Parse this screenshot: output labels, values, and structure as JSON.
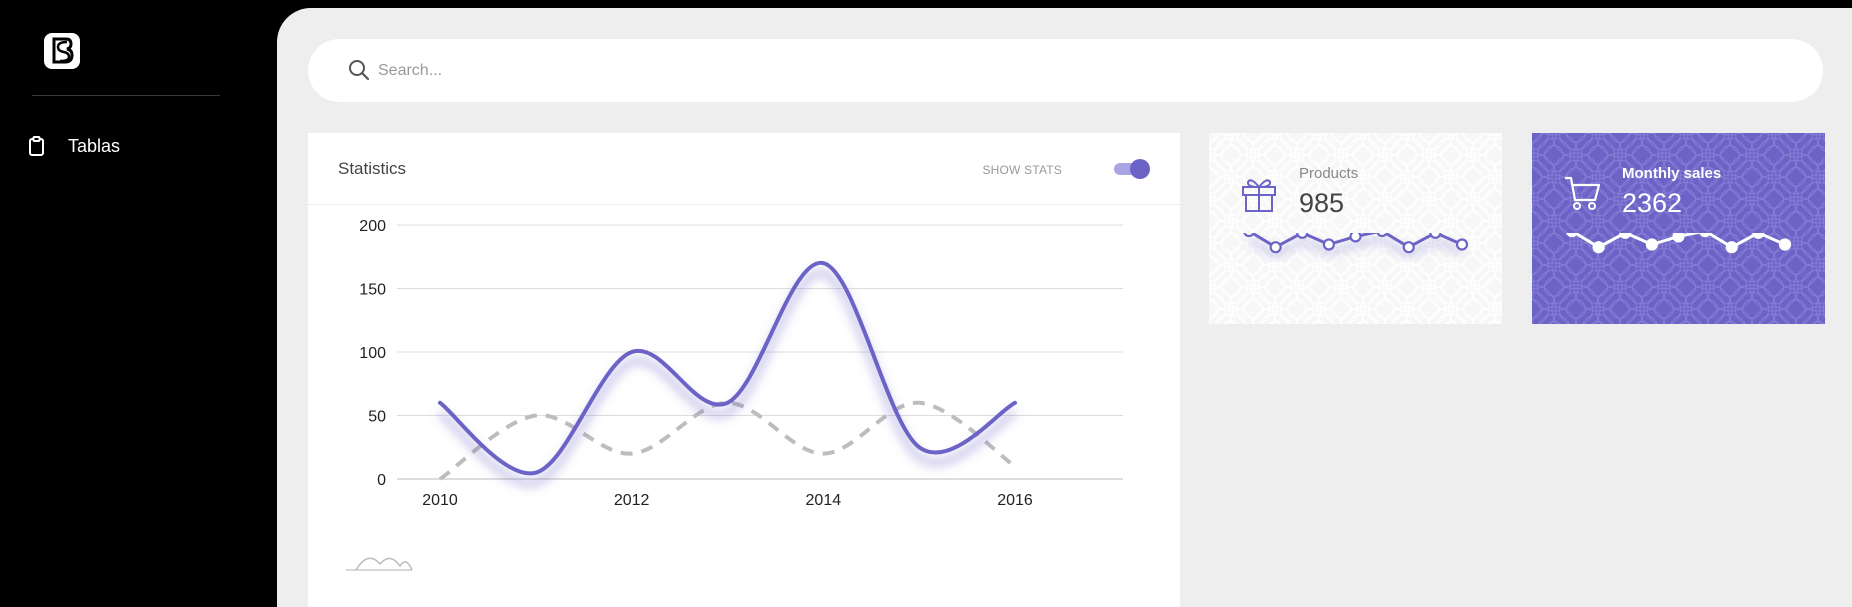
{
  "sidebar": {
    "logo_icon": "logo-icon",
    "items": [
      {
        "label": "Tablas",
        "icon": "clipboard-icon"
      }
    ]
  },
  "search": {
    "placeholder": "Search...",
    "icon": "search-icon"
  },
  "statistics": {
    "title": "Statistics",
    "toggle_label": "SHOW STATS",
    "toggle_on": true
  },
  "products": {
    "label": "Products",
    "value": "985",
    "icon": "gift-icon",
    "spark": [
      60,
      42,
      58,
      45,
      54,
      60,
      42,
      58,
      45
    ]
  },
  "monthly_sales": {
    "label": "Monthly sales",
    "value": "2362",
    "icon": "cart-icon",
    "spark": [
      60,
      42,
      58,
      45,
      54,
      60,
      42,
      58,
      45
    ]
  },
  "colors": {
    "accent": "#6c63c7",
    "secondary_series": "#bdbdbd",
    "background": "#eeeeee",
    "sidebar": "#000000"
  },
  "chart_data": {
    "type": "line",
    "x": [
      2010,
      2011,
      2012,
      2013,
      2014,
      2015,
      2016
    ],
    "x_tick_labels": [
      "2010",
      "2012",
      "2014",
      "2016"
    ],
    "y_ticks": [
      0,
      50,
      100,
      150,
      200
    ],
    "ylim": [
      0,
      200
    ],
    "grid": true,
    "series": [
      {
        "values": [
          60,
          5,
          100,
          60,
          170,
          25,
          60
        ],
        "color": "#6c63c7",
        "style": "solid"
      },
      {
        "values": [
          0,
          50,
          20,
          60,
          20,
          60,
          10
        ],
        "color": "#bdbdbd",
        "style": "dashed"
      }
    ]
  }
}
